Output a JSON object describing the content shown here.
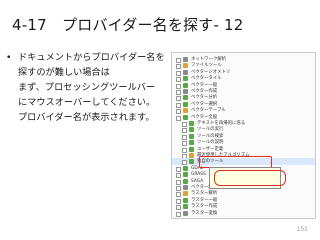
{
  "slide": {
    "title": "4-17　プロバイダー名を探す- 12",
    "bullet": "•",
    "bullet_lines": [
      "ドキュメントからプロバイダー名を",
      "探すのが難しい場合は",
      "まず、プロセッシングツールバー",
      "にマウスオーバーしてください。",
      "プロバイダー名が表示されます。"
    ],
    "page_number": "151"
  },
  "panel": {
    "rows": [
      "ネットワーク解析",
      "ファイルツール",
      "ベクタージオメトリ",
      "ベクタータイル",
      "ベクター一般",
      "ベクター作成",
      "ベクター分析",
      "ベクター選択",
      "ベクターテーブル",
      "ベクター全般",
      "テキストを再帰的に巡る",
      "ツールの実行",
      "ツールの検索",
      "ツールの説明",
      "ユーザー定義",
      "最近使用したアルゴリズム",
      "独自のツール",
      "GDAL",
      "GRASS",
      "SAGA",
      "ベクター解析",
      "ラスター解析",
      "ラスター一般",
      "ラスター作成",
      "ラスター変換"
    ],
    "tooltip_line1": "",
    "tooltip_line2": "",
    "colors": {
      "highlight": "#d9302b",
      "icon_green": "#5aa64a",
      "icon_gold": "#d9a23a",
      "icon_gray": "#8a8a8a"
    }
  }
}
